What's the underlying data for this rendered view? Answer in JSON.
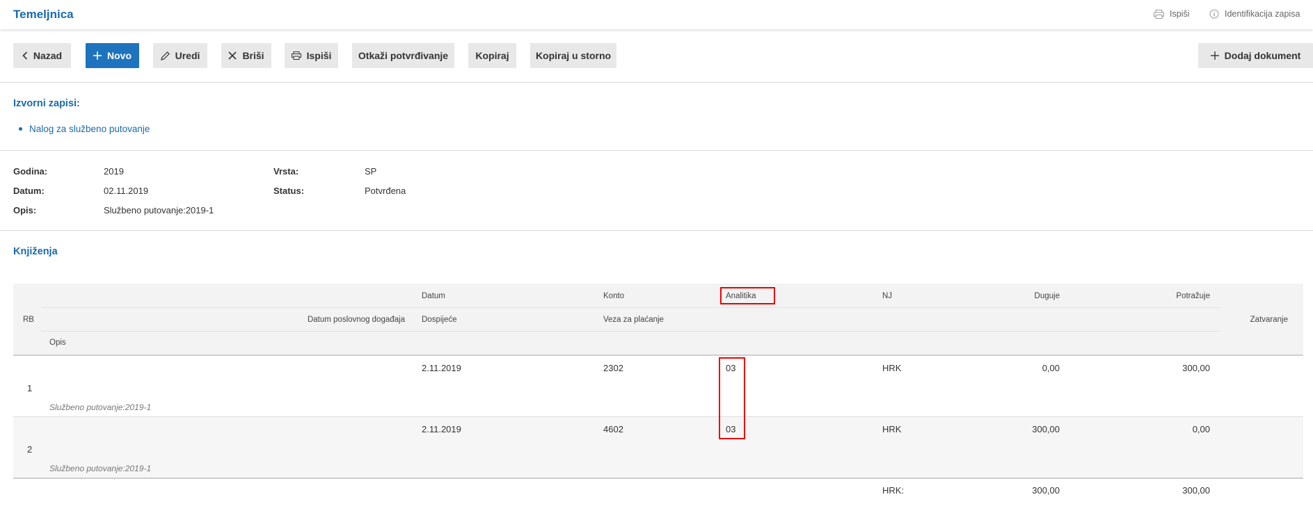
{
  "header": {
    "title": "Temeljnica",
    "print_label": "Ispiši",
    "identification_label": "Identifikacija zapisa"
  },
  "toolbar": {
    "back": "Nazad",
    "new": "Novo",
    "edit": "Uredi",
    "delete": "Briši",
    "print": "Ispiši",
    "cancel_confirm": "Otkaži potvrđivanje",
    "copy": "Kopiraj",
    "copy_storno": "Kopiraj u storno",
    "add_document": "Dodaj dokument"
  },
  "sources": {
    "title": "Izvorni zapisi:",
    "items": [
      "Nalog za službeno putovanje"
    ]
  },
  "details": {
    "year_label": "Godina:",
    "year": "2019",
    "date_label": "Datum:",
    "date": "02.11.2019",
    "desc_label": "Opis:",
    "desc": "Službeno putovanje:2019-1",
    "type_label": "Vrsta:",
    "type": "SP",
    "status_label": "Status:",
    "status": "Potvrđena"
  },
  "postings": {
    "title": "Knjiženja",
    "columns": {
      "rb": "RB",
      "datum": "Datum",
      "konto": "Konto",
      "analitika": "Analitika",
      "nj": "NJ",
      "duguje": "Duguje",
      "potrazuje": "Potražuje",
      "datum_poslovnog": "Datum poslovnog događaja",
      "dospijece": "Dospijeće",
      "veza": "Veza za plaćanje",
      "zatvaranje": "Zatvaranje",
      "opis": "Opis"
    },
    "rows": [
      {
        "rb": "1",
        "datum": "2.11.2019",
        "konto": "2302",
        "analitika": "03",
        "nj": "HRK",
        "duguje": "0,00",
        "potrazuje": "300,00",
        "opis": "Službeno putovanje:2019-1"
      },
      {
        "rb": "2",
        "datum": "2.11.2019",
        "konto": "4602",
        "analitika": "03",
        "nj": "HRK",
        "duguje": "300,00",
        "potrazuje": "0,00",
        "opis": "Službeno putovanje:2019-1"
      }
    ],
    "totals": {
      "currency": "HRK:",
      "duguje": "300,00",
      "potrazuje": "300,00"
    }
  },
  "colors": {
    "accent": "#1a6aad",
    "primary_button": "#1e73be",
    "highlight": "#e00000"
  }
}
